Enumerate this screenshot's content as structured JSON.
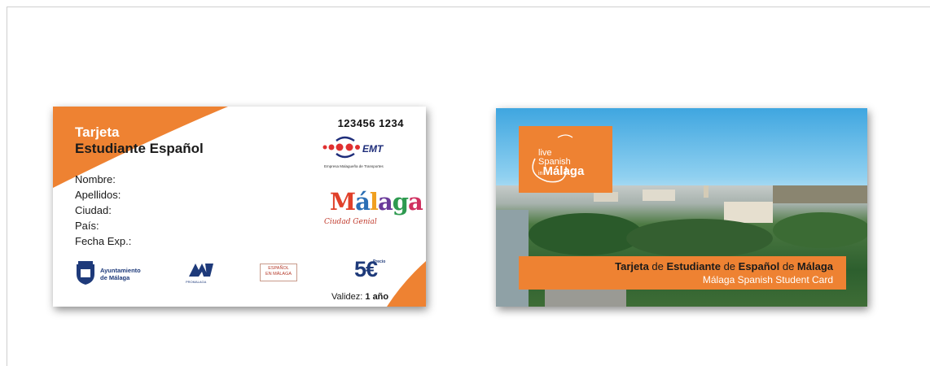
{
  "front_card": {
    "title_line1": "Tarjeta",
    "title_line2": "Estudiante Español",
    "card_number": "123456 1234",
    "fields": [
      "Nombre:",
      "Apellidos:",
      "Ciudad:",
      "País:",
      "Fecha Exp.:"
    ],
    "emt": {
      "name": "EMT",
      "subtitle": "Empresa Malagueña de Transportes"
    },
    "malaga_logo": {
      "word": "Málaga",
      "tagline": "Ciudad Genial"
    },
    "ayuntamiento": {
      "line1": "Ayuntamiento",
      "line2": "de Málaga"
    },
    "promalaga": "PROMALAGA",
    "espanol_logo": {
      "line1": "ESPAÑOL",
      "line2": "EN MÁLAGA"
    },
    "price_label": "Precio",
    "price": "5€",
    "validity_label": "Validez:",
    "validity_value": "1 año",
    "accent_color": "#ee8232"
  },
  "back_card": {
    "logo": {
      "line1": "live",
      "line2": "Spanish",
      "line3": "in",
      "line4": "Málaga"
    },
    "banner": {
      "w1": "Tarjeta",
      "w2": " de ",
      "w3": "Estudiante",
      "w4": " de ",
      "w5": "Español",
      "w6": " de ",
      "w7": "Málaga",
      "english": "Málaga Spanish Student Card"
    }
  }
}
